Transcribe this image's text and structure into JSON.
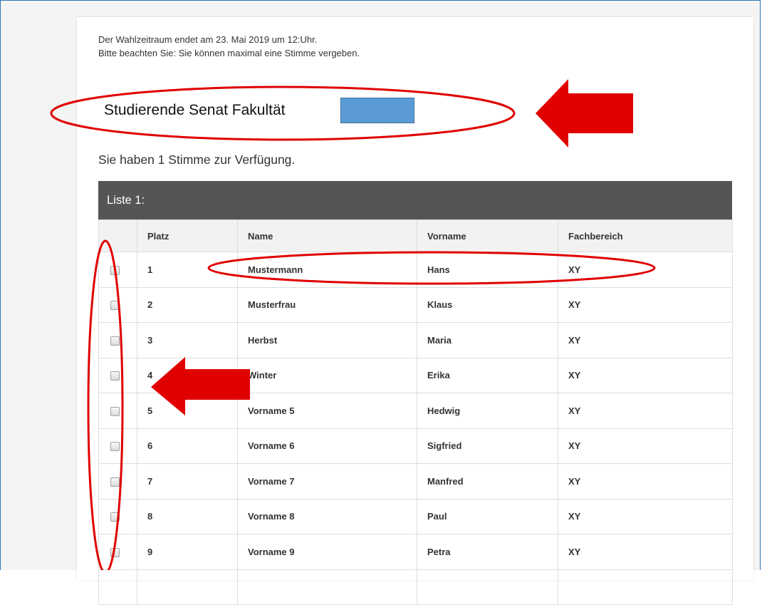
{
  "notice": {
    "line1": "Der Wahlzeitraum endet am 23. Mai 2019 um 12:Uhr.",
    "line2": "Bitte beachten Sie: Sie können maximal eine Stimme vergeben."
  },
  "election": {
    "title": "Studierende Senat Fakultät"
  },
  "votes_info": "Sie haben 1 Stimme zur Verfügung.",
  "list": {
    "title": "Liste 1:",
    "columns": [
      "Platz",
      "Name",
      "Vorname",
      "Fachbereich"
    ],
    "rows": [
      {
        "platz": "1",
        "name": "Mustermann",
        "vorname": "Hans",
        "fachbereich": "XY"
      },
      {
        "platz": "2",
        "name": "Musterfrau",
        "vorname": "Klaus",
        "fachbereich": "XY"
      },
      {
        "platz": "3",
        "name": "Herbst",
        "vorname": "Maria",
        "fachbereich": "XY"
      },
      {
        "platz": "4",
        "name": "Winter",
        "vorname": "Erika",
        "fachbereich": "XY"
      },
      {
        "platz": "5",
        "name": "Vorname 5",
        "vorname": "Hedwig",
        "fachbereich": "XY"
      },
      {
        "platz": "6",
        "name": "Vorname 6",
        "vorname": "Sigfried",
        "fachbereich": "XY"
      },
      {
        "platz": "7",
        "name": "Vorname 7",
        "vorname": "Manfred",
        "fachbereich": "XY"
      },
      {
        "platz": "8",
        "name": "Vorname 8",
        "vorname": "Paul",
        "fachbereich": "XY"
      },
      {
        "platz": "9",
        "name": "Vorname 9",
        "vorname": "Petra",
        "fachbereich": "XY"
      },
      {
        "platz": "",
        "name": "",
        "vorname": "",
        "fachbereich": ""
      }
    ]
  },
  "colors": {
    "header_bg": "#555555",
    "annotation_red": "#e00000",
    "highlight_box": "#5b9bd5"
  }
}
